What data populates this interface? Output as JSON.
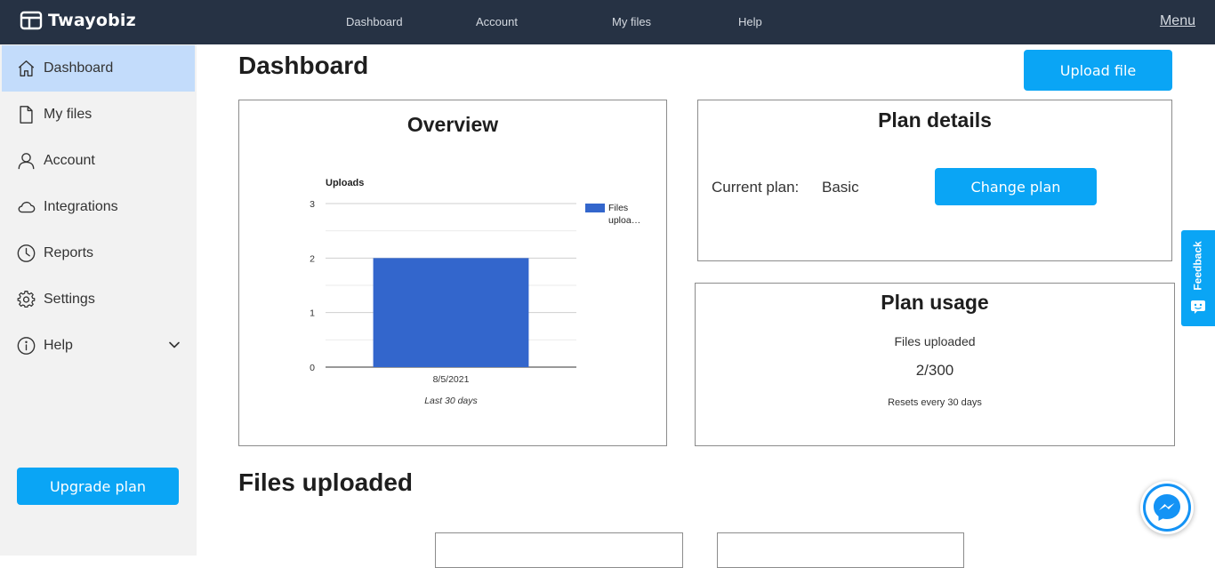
{
  "app": {
    "brand": "Twayobiz"
  },
  "topnav": {
    "dashboard": "Dashboard",
    "account": "Account",
    "my_files": "My files",
    "help": "Help",
    "menu": "Menu"
  },
  "sidebar": {
    "items": [
      {
        "label": "Dashboard",
        "icon": "home-icon"
      },
      {
        "label": "My files",
        "icon": "file-icon"
      },
      {
        "label": "Account",
        "icon": "user-icon"
      },
      {
        "label": "Integrations",
        "icon": "cloud-icon"
      },
      {
        "label": "Reports",
        "icon": "clock-icon"
      },
      {
        "label": "Settings",
        "icon": "gear-icon"
      },
      {
        "label": "Help",
        "icon": "info-icon"
      }
    ],
    "upgrade_label": "Upgrade plan"
  },
  "main": {
    "title": "Dashboard",
    "upload_label": "Upload file",
    "files_title": "Files uploaded"
  },
  "overview": {
    "title": "Overview"
  },
  "plan_details": {
    "title": "Plan details",
    "current_plan_label": "Current plan:",
    "current_plan_value": "Basic",
    "change_label": "Change plan"
  },
  "plan_usage": {
    "title": "Plan usage",
    "files_label": "Files uploaded",
    "files_value": "2/300",
    "reset_note": "Resets every 30 days"
  },
  "widgets": {
    "feedback_label": "Feedback"
  },
  "colors": {
    "accent": "#0aa5f5",
    "topbar": "#263244",
    "sidebar_active": "#c3dcfb",
    "bar": "#3366cc"
  },
  "chart_data": {
    "type": "bar",
    "title": "Uploads",
    "categories": [
      "8/5/2021"
    ],
    "series": [
      {
        "name": "Files uploa...",
        "values": [
          2
        ]
      }
    ],
    "ylim": [
      0,
      3
    ],
    "yticks": [
      0,
      1,
      2,
      3
    ],
    "xlabel": "Last 30 days",
    "ylabel": "",
    "legend": "right",
    "grid": true
  }
}
